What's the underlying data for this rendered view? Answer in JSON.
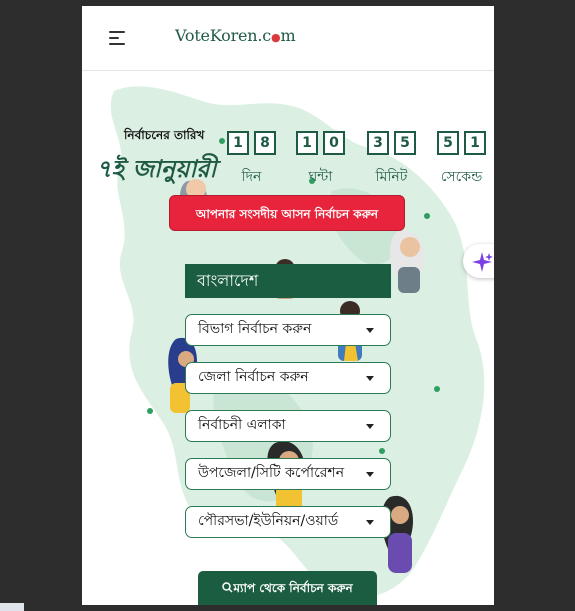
{
  "header": {
    "logo_prefix": "VoteKoren.c",
    "logo_dot": "●",
    "logo_suffix": "m"
  },
  "election": {
    "date_label": "নির্বাচনের তারিখ",
    "date_value": "৭ই জানুয়ারী"
  },
  "countdown": [
    {
      "digits": [
        "1",
        "8"
      ],
      "unit": "দিন"
    },
    {
      "digits": [
        "1",
        "0"
      ],
      "unit": "ঘন্টা"
    },
    {
      "digits": [
        "3",
        "5"
      ],
      "unit": "মিনিট"
    },
    {
      "digits": [
        "5",
        "1"
      ],
      "unit": "সেকেন্ড"
    }
  ],
  "select_seat_button": "আপনার সংসদীয় আসন নির্বাচন করুন",
  "form": {
    "country": "বাংলাদেশ",
    "division": "বিভাগ নির্বাচন করুন",
    "district": "জেলা নির্বাচন করুন",
    "constituency": "নির্বাচনী এলাকা",
    "upazila": "উপজেলা/সিটি কর্পোরেশন",
    "union": "পৌরসভা/ইউনিয়ন/ওয়ার্ড"
  },
  "map_button": "ম্যাপ থেকে নির্বাচন করুন",
  "colors": {
    "brand_green": "#1b5d40",
    "accent_red": "#e8243c",
    "map_green": "#dcefe3"
  }
}
